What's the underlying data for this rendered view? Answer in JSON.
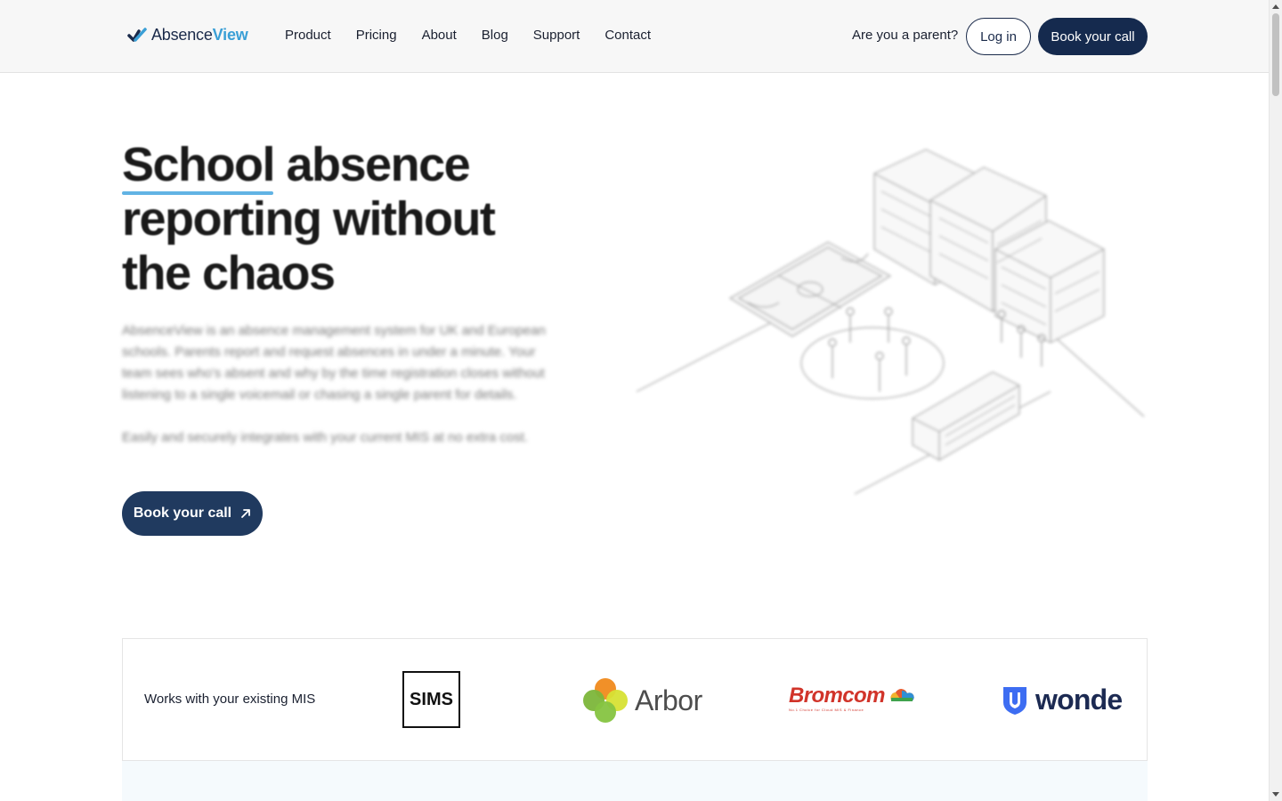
{
  "header": {
    "logo": {
      "part1": "Absence",
      "part2": "View"
    },
    "nav": [
      "Product",
      "Pricing",
      "About",
      "Blog",
      "Support",
      "Contact"
    ],
    "parent_link": "Are you a parent?",
    "login_label": "Log in",
    "book_label": "Book your call"
  },
  "hero": {
    "title_lines": [
      "School absence",
      "reporting without",
      "the chaos"
    ],
    "description": "AbsenceView is an absence management system for UK and European schools. Parents report and request absences in under a minute. Your team sees who's absent and why by the time registration closes without listening to a single voicemail or chasing a single parent for details.",
    "description2": "Easily and securely integrates with your current MIS at no extra cost.",
    "cta_label": "Book your call",
    "cta_icon": "arrow-up-right-icon"
  },
  "mis": {
    "label": "Works with your existing MIS",
    "logos": {
      "sims": "SIMS",
      "arbor": "Arbor",
      "bromcom": "Bromcom",
      "bromcom_tagline": "No.1 Choice for Cloud MIS & Finance",
      "wonde": "wonde"
    }
  },
  "colors": {
    "navy": "#152a4e",
    "accent_blue": "#3a9fd6",
    "underline": "#61b3e4"
  }
}
